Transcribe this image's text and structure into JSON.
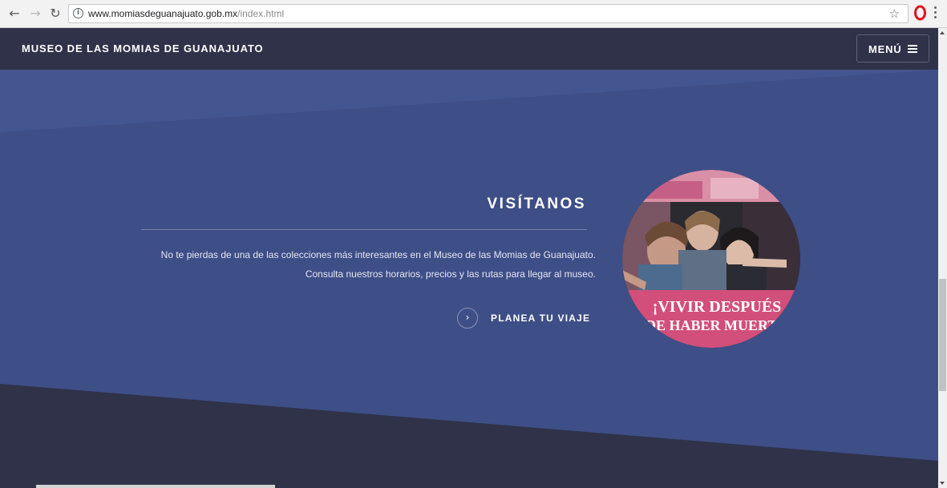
{
  "browser": {
    "url_host": "www.momiasdeguanajuato.gob.mx",
    "url_path": "/index.html",
    "icons": [
      "back-icon",
      "forward-icon",
      "reload-icon",
      "info-icon",
      "star-icon",
      "opera-icon",
      "menu-kebab-icon"
    ]
  },
  "header": {
    "title": "MUSEO DE LAS MOMIAS DE GUANAJUATO",
    "menu_label": "MENÚ"
  },
  "hero": {
    "heading": "VISÍTANOS",
    "description": "No te pierdas de una de las colecciones más interesantes en el Museo de las Momias de Guanajuato. Consulta nuestros horarios, precios y las rutas para llegar al museo.",
    "cta_label": "PLANEA TU VIAJE",
    "photo_banner_line1": "¡VIVIR DESPUÉS",
    "photo_banner_line2": "DE HABER MUERTO"
  },
  "colors": {
    "header_bg": "#2f3249",
    "hero_bg": "#3e4e87",
    "hero_band_light": "#44568f",
    "footer_dark": "#2f3249",
    "accent_pink": "#d14f7a"
  }
}
